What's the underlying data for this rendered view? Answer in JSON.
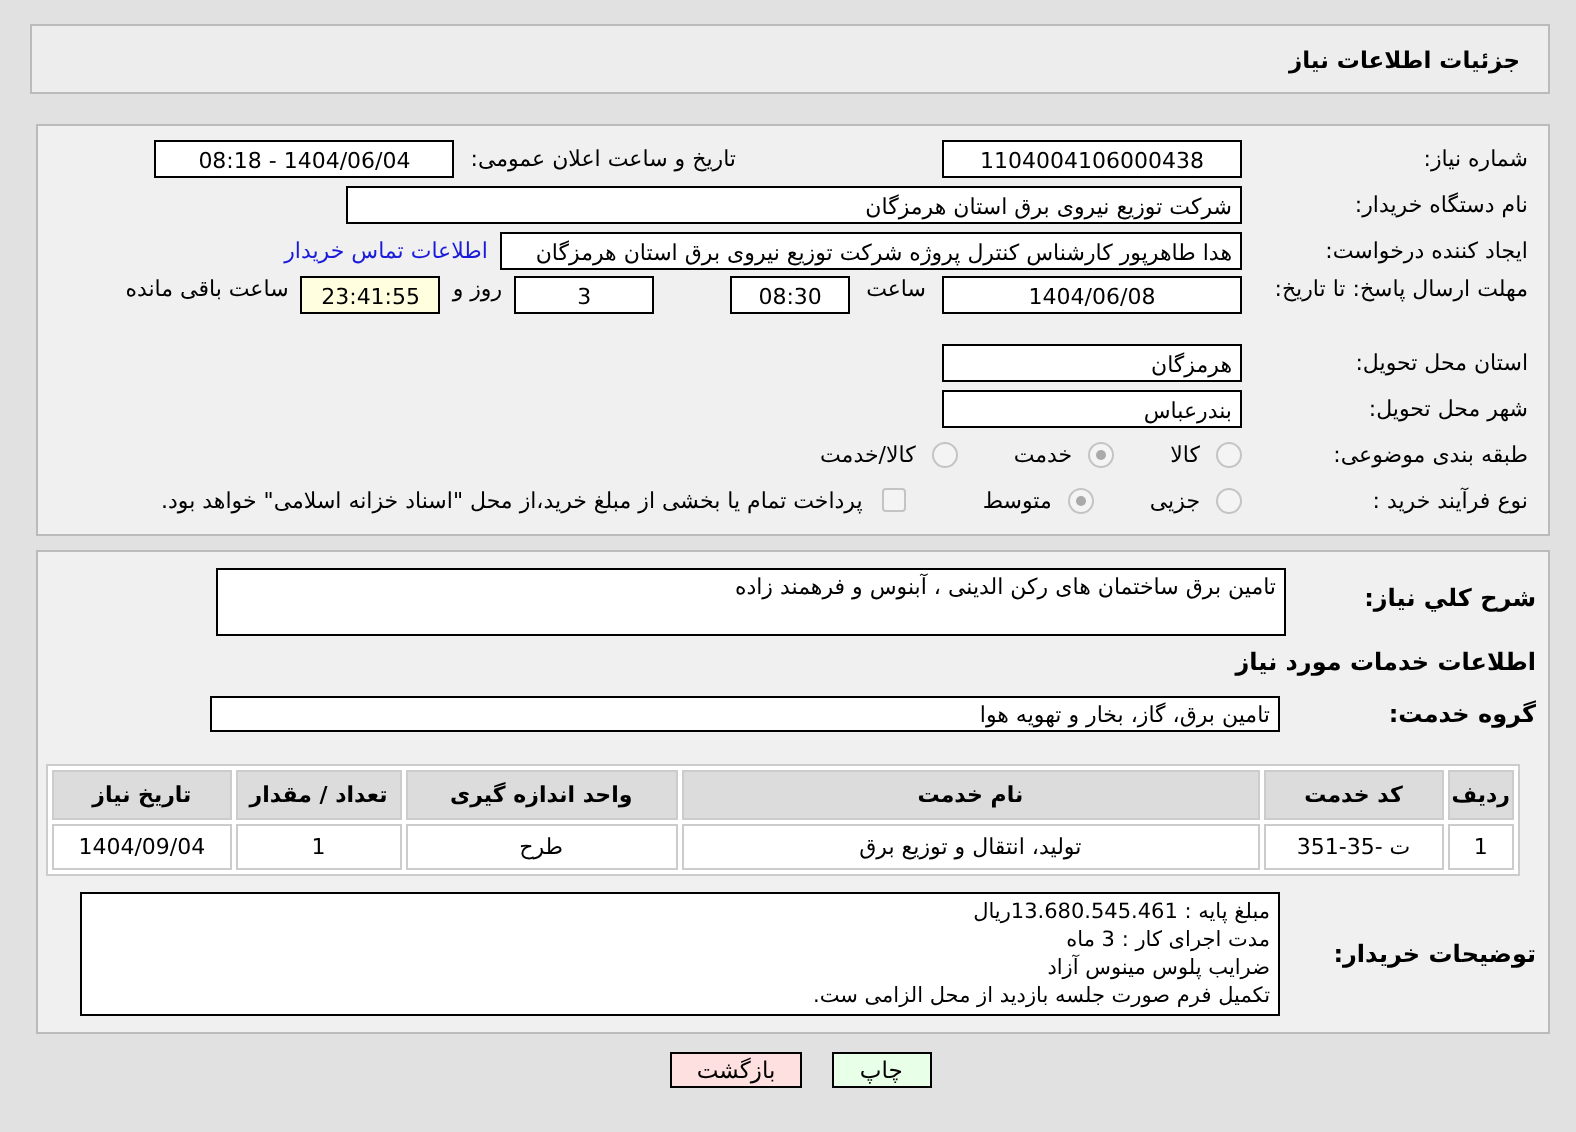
{
  "header": {
    "title": "جزئیات اطلاعات نیاز"
  },
  "form": {
    "need_number": {
      "label": "شماره نیاز:",
      "value": "1104004106000438"
    },
    "announce_datetime": {
      "label": "تاریخ و ساعت اعلان عمومی:",
      "value": "1404/06/04 - 08:18"
    },
    "buyer_org": {
      "label": "نام دستگاه خریدار:",
      "value": "شرکت توزیع نیروی برق استان هرمزگان"
    },
    "requester": {
      "label": "ایجاد کننده درخواست:",
      "value": "هدا طاهرپور کارشناس کنترل پروژه شرکت توزیع نیروی برق استان هرمزگان",
      "link": "اطلاعات تماس خریدار"
    },
    "deadline": {
      "label": "مهلت ارسال پاسخ: تا تاریخ:",
      "date": "1404/06/08",
      "time_label": "ساعت",
      "time": "08:30",
      "days": "3",
      "days_label": "روز و",
      "remaining": "23:41:55",
      "remaining_label": "ساعت باقی مانده"
    },
    "province": {
      "label": "استان محل تحویل:",
      "value": "هرمزگان"
    },
    "city": {
      "label": "شهر محل تحویل:",
      "value": "بندرعباس"
    },
    "category": {
      "label": "طبقه بندی موضوعی:",
      "options": [
        {
          "label": "کالا",
          "selected": false
        },
        {
          "label": "خدمت",
          "selected": true
        },
        {
          "label": "کالا/خدمت",
          "selected": false
        }
      ]
    },
    "process": {
      "label": "نوع فرآیند خرید :",
      "options": [
        {
          "label": "جزیی",
          "selected": false
        },
        {
          "label": "متوسط",
          "selected": true
        }
      ],
      "payment_note": {
        "label": "پرداخت تمام یا بخشی از مبلغ خرید،از محل \"اسناد خزانه اسلامی\" خواهد بود.",
        "checked": false
      }
    }
  },
  "details": {
    "summary": {
      "label": "شرح کلي نياز:",
      "value": "تامین برق ساختمان های رکن الدینی ، آبنوس و فرهمند زاده"
    },
    "section_title": "اطلاعات خدمات مورد نیاز",
    "service_group": {
      "label": "گروه خدمت:",
      "value": "تامین برق، گاز، بخار و تهویه هوا"
    },
    "table": {
      "columns": [
        "ردیف",
        "کد خدمت",
        "نام خدمت",
        "واحد اندازه گیری",
        "تعداد / مقدار",
        "تاریخ نیاز"
      ],
      "rows": [
        [
          "1",
          "ت -35-351",
          "تولید، انتقال و توزیع برق",
          "طرح",
          "1",
          "1404/09/04"
        ]
      ]
    },
    "buyer_notes": {
      "label": "توضیحات خریدار:",
      "lines": [
        "مبلغ پایه : 13.680.545.461ریال",
        "مدت اجرای کار : 3 ماه",
        "ضرایب پلوس مینوس آزاد",
        "تکمیل فرم صورت جلسه بازدید از محل الزامی ست."
      ]
    }
  },
  "buttons": [
    {
      "label": "چاپ",
      "kind": "print"
    },
    {
      "label": "بازگشت",
      "kind": "back"
    }
  ]
}
